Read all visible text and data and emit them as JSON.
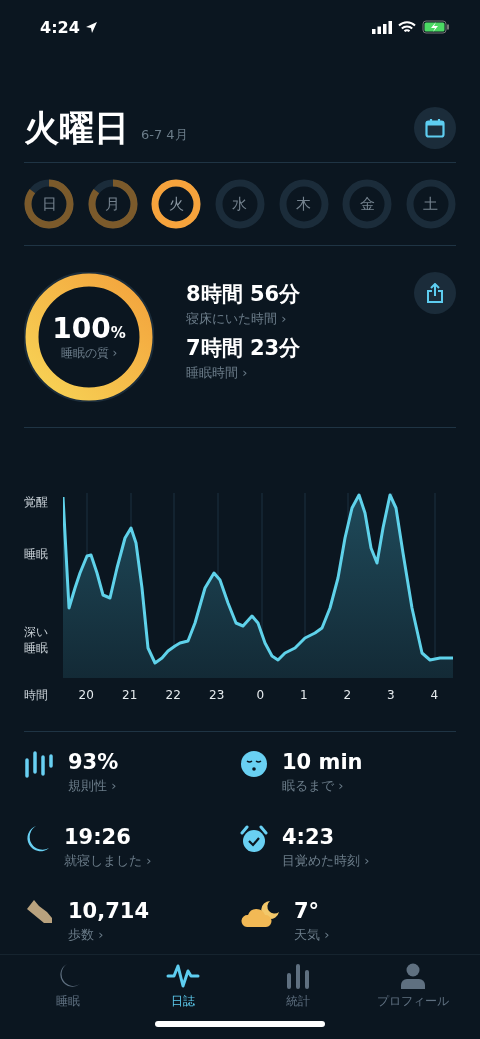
{
  "status_bar": {
    "time": "4:24"
  },
  "header": {
    "title": "火曜日",
    "date_range": "6-7 4月"
  },
  "days": [
    {
      "label": "日",
      "level": 0.85,
      "selected": false
    },
    {
      "label": "月",
      "level": 0.85,
      "selected": false
    },
    {
      "label": "火",
      "level": 1,
      "selected": true
    },
    {
      "label": "水",
      "selected": false
    },
    {
      "label": "木",
      "selected": false
    },
    {
      "label": "金",
      "selected": false
    },
    {
      "label": "土",
      "selected": false
    }
  ],
  "quality": {
    "value": "100",
    "unit": "%",
    "label": "睡眠の質 ›",
    "level": 1
  },
  "durations": [
    {
      "value": "8時間 56分",
      "label": "寝床にいた時間 ›"
    },
    {
      "value": "7時間 23分",
      "label": "睡眠時間 ›"
    }
  ],
  "chart": {
    "y_labels": [
      "覚醒",
      "睡眠",
      "深い睡眠"
    ],
    "x_axis_label": "時間",
    "x_labels": [
      "20",
      "21",
      "22",
      "23",
      "0",
      "1",
      "2",
      "3",
      "4"
    ]
  },
  "stats": [
    {
      "kind": "regularity",
      "value": "93%",
      "label": "規則性 ›"
    },
    {
      "kind": "latency",
      "value": "10 min",
      "label": "眠るまで ›"
    },
    {
      "kind": "bedtime",
      "value": "19:26",
      "label": "就寝しました ›"
    },
    {
      "kind": "wake",
      "value": "4:23",
      "label": "目覚めた時刻 ›"
    },
    {
      "kind": "steps",
      "value": "10,714",
      "label": "歩数 ›"
    },
    {
      "kind": "weather",
      "value": "7°",
      "label": "天気 ›"
    }
  ],
  "tab_bar": [
    {
      "kind": "sleep",
      "label": "睡眠",
      "selected": false
    },
    {
      "kind": "journal",
      "label": "日誌",
      "selected": true
    },
    {
      "kind": "stats",
      "label": "統計",
      "selected": false
    },
    {
      "kind": "profile",
      "label": "プロフィール",
      "selected": false
    }
  ]
}
